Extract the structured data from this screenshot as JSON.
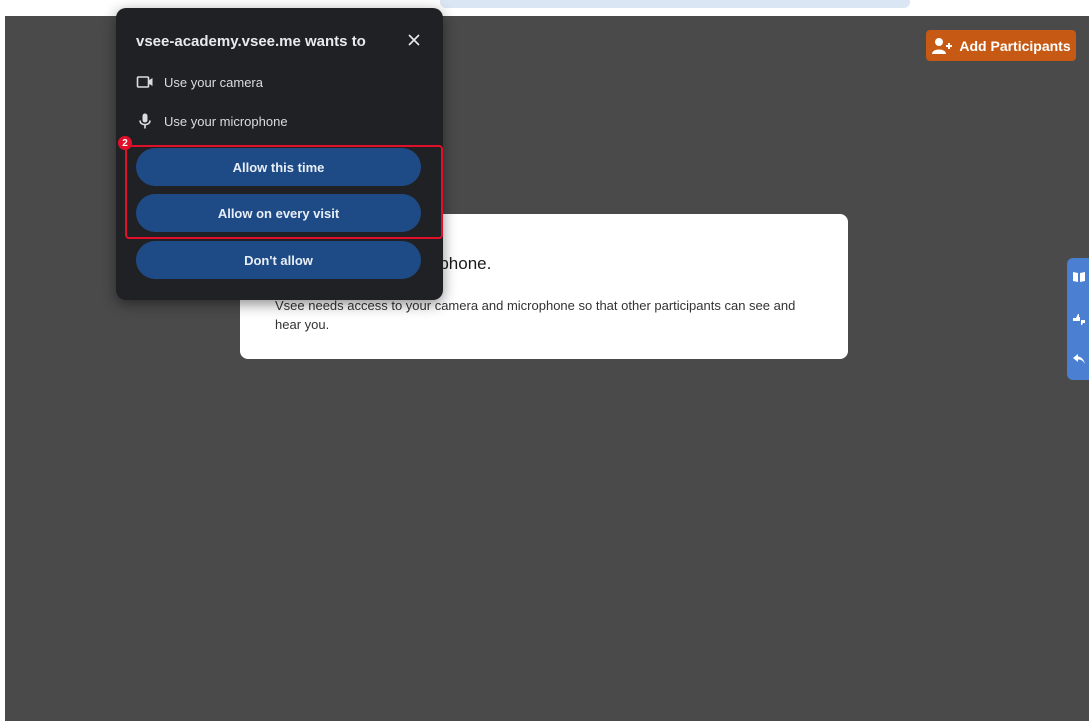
{
  "header": {
    "add_participants_label": "Add Participants",
    "add_participants_icon": "add-user-icon"
  },
  "card": {
    "title": "our camera and microphone.",
    "body": "Vsee needs access to your camera and microphone so that other participants can see and hear you."
  },
  "permission_dialog": {
    "title": "vsee-academy.vsee.me wants to",
    "permissions": [
      {
        "label": "Use your camera",
        "icon": "camera-icon"
      },
      {
        "label": "Use your microphone",
        "icon": "microphone-icon"
      }
    ],
    "buttons": {
      "allow_this_time": "Allow this time",
      "allow_every_visit": "Allow on every visit",
      "dont_allow": "Don't allow"
    }
  },
  "annotation": {
    "step_number": "2"
  },
  "side_panel_icons": [
    "book-icon",
    "thumbs-icon",
    "reply-icon"
  ],
  "colors": {
    "stage_bg": "#4a4a4a",
    "add_button": "#c65a14",
    "dialog_bg": "#202124",
    "dialog_button": "#1e4b85",
    "highlight": "#e0102a",
    "side_panel": "#4a7fd1"
  }
}
